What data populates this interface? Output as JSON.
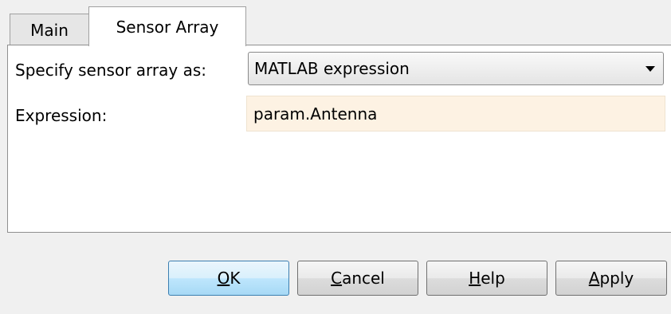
{
  "tabs": [
    {
      "label": "Main",
      "active": false
    },
    {
      "label": "Sensor Array",
      "active": true
    }
  ],
  "form": {
    "specify_label": "Specify sensor array as:",
    "specify_value": "MATLAB expression",
    "expression_label": "Expression:",
    "expression_value": "param.Antenna"
  },
  "buttons": {
    "ok": {
      "mnemonic": "O",
      "rest": "K"
    },
    "cancel": {
      "mnemonic": "C",
      "rest": "ancel"
    },
    "help": {
      "mnemonic": "H",
      "rest": "elp"
    },
    "apply": {
      "mnemonic": "A",
      "rest": "pply"
    }
  },
  "colors": {
    "expression_field_background": "#fdf2e3",
    "default_button_border": "#3c7fb1"
  },
  "icons": {
    "dropdown": "chevron-down-icon"
  }
}
